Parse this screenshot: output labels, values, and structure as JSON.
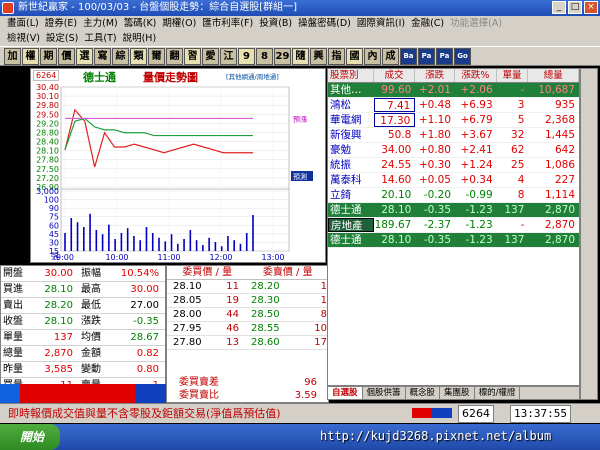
{
  "window": {
    "title": "新世紀贏家 - 100/03/03 - 台盤個股走勢：綜合自選股[群組一]"
  },
  "menu": {
    "row1": [
      "畫面(L)",
      "證券(E)",
      "主力(M)",
      "籌碼(K)",
      "期權(O)",
      "匯市利率(F)",
      "投資(B)",
      "操盤密碼(D)",
      "國際資訊(I)",
      "金融(C)",
      "功能選擇(A)"
    ],
    "row1_dim": "功能選擇(A)",
    "row2": [
      "檢視(V)",
      "設定(S)",
      "工具(T)",
      "說明(H)"
    ]
  },
  "toolbar": [
    "加",
    "權",
    "期",
    "價",
    "選",
    "寫",
    "綜",
    "類",
    "爾",
    "翻",
    "習",
    "愛",
    "江",
    "9",
    "8",
    "29",
    "隨",
    "興",
    "指",
    "國",
    "內",
    "成",
    "Ba",
    "Pa",
    "Pa",
    "Go"
  ],
  "chart": {
    "code": "6264",
    "stock_name": "德士通",
    "title": "量價走勢圖",
    "note": "[其他網通/周地通]",
    "legend_tag": "預測",
    "legend_tag2": "預漲"
  },
  "chart_data": {
    "type": "line",
    "title": "德士通 量價走勢圖",
    "price_axis": [
      30.4,
      30.1,
      29.8,
      29.5,
      29.2,
      28.8,
      28.4,
      28.1,
      27.8,
      27.5,
      27.2,
      26.9
    ],
    "volume_axis": [
      3000,
      100,
      90,
      75,
      60,
      45,
      30,
      15
    ],
    "volume_axis_labels": [
      "3,000",
      "100",
      "90",
      "75",
      "60",
      "45",
      "30",
      "15"
    ],
    "volume_unit": "張",
    "time_ticks": [
      "9:00",
      "10:00",
      "11:00",
      "12:00",
      "13:00"
    ],
    "series": [
      {
        "name": "price",
        "color": "#e02020",
        "values": [
          28.2,
          29.6,
          29.2,
          27.6,
          28.8,
          28.3,
          28.3,
          28.4,
          28.3,
          28.2,
          28.1,
          28.2,
          28.3,
          28.4,
          28.3,
          28.2,
          28.1,
          28.1,
          28.1,
          28.1
        ]
      },
      {
        "name": "avg",
        "color": "#20a040",
        "values": [
          28.2,
          29.2,
          29.3,
          29.0,
          28.9,
          28.9,
          28.8,
          28.8,
          28.8,
          28.7,
          28.7,
          28.7,
          28.7,
          28.7,
          28.7,
          28.7,
          28.7,
          28.7,
          28.7,
          28.7
        ]
      },
      {
        "name": "ref",
        "color": "#d060d0",
        "values": [
          29.3,
          29.3,
          29.3,
          29.3,
          29.3,
          29.3,
          29.3,
          29.3,
          29.3,
          29.3,
          29.3,
          29.3,
          29.3,
          29.3,
          29.3,
          29.3,
          29.3,
          29.3,
          29.3,
          29.3
        ]
      }
    ],
    "volume": [
      30,
      55,
      48,
      40,
      62,
      35,
      28,
      44,
      20,
      30,
      38,
      25,
      18,
      40,
      30,
      22,
      16,
      28,
      12,
      20,
      35,
      18,
      10,
      22,
      15,
      8,
      25,
      18,
      12,
      30,
      60
    ],
    "ylim": [
      26.9,
      30.4
    ]
  },
  "info": {
    "rows": [
      {
        "l": "開盤",
        "v": "30.00",
        "vc": "red",
        "l2": "振幅",
        "v2": "10.54%",
        "v2c": "red"
      },
      {
        "l": "買進",
        "v": "28.10",
        "vc": "green",
        "l2": "最高",
        "v2": "30.00",
        "v2c": "red"
      },
      {
        "l": "賣出",
        "v": "28.20",
        "vc": "green",
        "l2": "最低",
        "v2": "27.00",
        "v2c": "black"
      },
      {
        "l": "收盤",
        "v": "28.10",
        "vc": "green",
        "l2": "漲跌",
        "v2": "-0.35",
        "v2c": "green"
      },
      {
        "l": "單量",
        "v": "137",
        "vc": "red",
        "l2": "均價",
        "v2": "28.67",
        "v2c": "green"
      },
      {
        "l": "總量",
        "v": "2,870",
        "vc": "red",
        "l2": "金額",
        "v2": "0.82",
        "v2c": "red"
      },
      {
        "l": "昨量",
        "v": "3,585",
        "vc": "red",
        "l2": "變動",
        "v2": "0.80",
        "v2c": "red"
      },
      {
        "l": "買量",
        "v": "11",
        "vc": "red",
        "l2": "賣量",
        "v2": "1",
        "v2c": "red"
      }
    ]
  },
  "book": {
    "bid_header": "委買價 / 量",
    "ask_header": "委賣價 / 量",
    "rows": [
      {
        "bp": "28.10",
        "bq": "11",
        "ap": "28.20",
        "aq": "1"
      },
      {
        "bp": "28.05",
        "bq": "19",
        "ap": "28.30",
        "aq": "1"
      },
      {
        "bp": "28.00",
        "bq": "44",
        "ap": "28.50",
        "aq": "8"
      },
      {
        "bp": "27.95",
        "bq": "46",
        "ap": "28.55",
        "aq": "10"
      },
      {
        "bp": "27.80",
        "bq": "13",
        "ap": "28.60",
        "aq": "17"
      }
    ],
    "diff_label": "委買賣差",
    "diff_value": "96",
    "ratio_label": "委買賣比",
    "ratio_value": "3.59"
  },
  "quotes": {
    "headers": [
      "股票別",
      "成交",
      "漲跌",
      "漲跌%",
      "單量",
      "總量"
    ],
    "rows": [
      {
        "name": "其他…",
        "price": "99.60",
        "chg": "+2.01",
        "pct": "+2.06",
        "vol": "-",
        "total": "10,687",
        "hl": true
      },
      {
        "name": "鴻松",
        "price": "7.41",
        "chg": "+0.48",
        "pct": "+6.93",
        "vol": "3",
        "total": "935",
        "box": true
      },
      {
        "name": "華電網",
        "price": "17.30",
        "chg": "+1.10",
        "pct": "+6.79",
        "vol": "5",
        "total": "2,368",
        "box": true
      },
      {
        "name": "新復興",
        "price": "50.8",
        "chg": "+1.80",
        "pct": "+3.67",
        "vol": "32",
        "total": "1,445"
      },
      {
        "name": "豪勉",
        "price": "34.00",
        "chg": "+0.80",
        "pct": "+2.41",
        "vol": "62",
        "total": "642"
      },
      {
        "name": "統振",
        "price": "24.55",
        "chg": "+0.30",
        "pct": "+1.24",
        "vol": "25",
        "total": "1,086"
      },
      {
        "name": "萬泰科",
        "price": "14.60",
        "chg": "+0.05",
        "pct": "+0.34",
        "vol": "4",
        "total": "227"
      },
      {
        "name": "立錡",
        "price": "20.10",
        "chg": "-0.20",
        "pct": "-0.99",
        "vol": "8",
        "total": "1,114"
      },
      {
        "name": "德士通",
        "price": "28.10",
        "chg": "-0.35",
        "pct": "-1.23",
        "vol": "137",
        "total": "2,870",
        "hl": true
      },
      {
        "name": "房地產",
        "price": "189.67",
        "chg": "-2.37",
        "pct": "-1.23",
        "vol": "-",
        "total": "2,870",
        "hl2": true
      },
      {
        "name": "德士通",
        "price": "28.10",
        "chg": "-0.35",
        "pct": "-1.23",
        "vol": "137",
        "total": "2,870",
        "hl": true
      }
    ]
  },
  "quote_tabs": [
    "自選股",
    "個股供籌",
    "概念股",
    "集團股",
    "標的/權證"
  ],
  "status": {
    "message": "即時報價成交值與量不含零股及鉅額交易(淨值爲預估值)",
    "code": "6264",
    "time": "13:37:55"
  },
  "taskbar": {
    "start": "開始",
    "url": "http://kujd3268.pixnet.net/album"
  }
}
